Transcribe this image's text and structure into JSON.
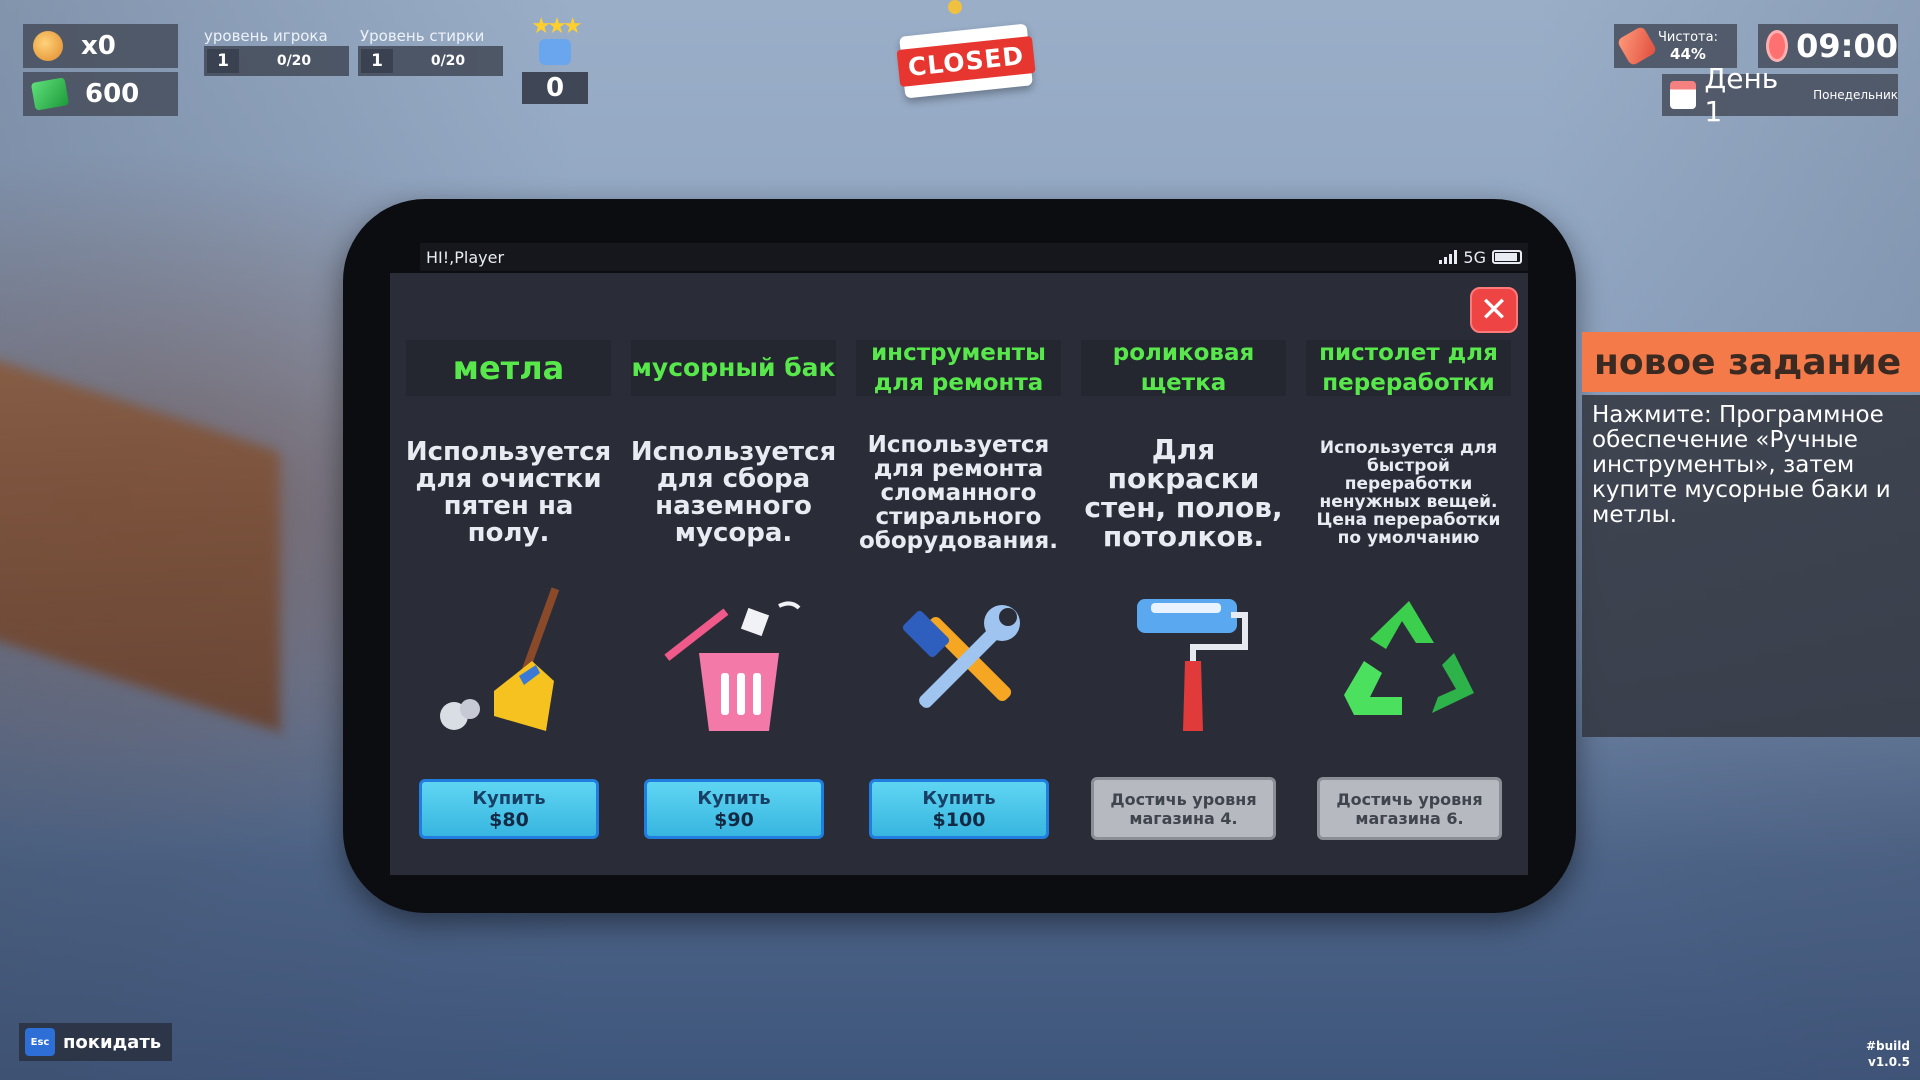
{
  "hud": {
    "tips_count": "x0",
    "money": "600",
    "player_level": {
      "label": "уровень игрока",
      "level": "1",
      "progress": "0/20"
    },
    "laundry_level": {
      "label": "Уровень стирки",
      "level": "1",
      "progress": "0/20"
    },
    "rating": "0",
    "closed_sign": "CLOSED",
    "cleanliness": {
      "label": "Чистота:",
      "value": "44%"
    },
    "time": "09:00",
    "day": "День 1",
    "weekday": "Понедельник"
  },
  "phone": {
    "greeting": "HI!,Player",
    "network": "5G",
    "close_symbol": "✕",
    "items": [
      {
        "title": "метла",
        "description": "Используется для очистки пятен на полу.",
        "button_label": "Купить",
        "price": "$80",
        "locked": false,
        "icon": "broom-icon"
      },
      {
        "title": "мусорный бак",
        "description": "Используется для сбора наземного мусора.",
        "button_label": "Купить",
        "price": "$90",
        "locked": false,
        "icon": "trash-bin-icon"
      },
      {
        "title": "инструменты для ремонта",
        "description": "Используется для ремонта сломанного стирального оборудования.",
        "button_label": "Купить",
        "price": "$100",
        "locked": false,
        "icon": "repair-tools-icon"
      },
      {
        "title": "роликовая щетка",
        "description": "Для покраски стен, полов, потолков.",
        "button_label": "Достичь уровня магазина 4.",
        "price": "",
        "locked": true,
        "icon": "paint-roller-icon"
      },
      {
        "title": "пистолет для переработки",
        "description": "Используется для быстрой переработки ненужных вещей. Цена переработки по умолчанию",
        "button_label": "Достичь уровня магазина 6.",
        "price": "",
        "locked": true,
        "icon": "recycle-icon"
      }
    ]
  },
  "quest": {
    "header": "новое задание",
    "text": "Нажмите: Программное обеспечение «Ручные инструменты», затем купите мусорные баки и метлы."
  },
  "footer": {
    "esc_key": "Esc",
    "leave_label": "покидать",
    "build_tag": "#build",
    "version": "v1.0.5"
  },
  "colors": {
    "accent_green": "#58e84c",
    "buy_button": "#38b6e0",
    "quest_header": "#f47a4a",
    "close_red": "#ee4444"
  }
}
